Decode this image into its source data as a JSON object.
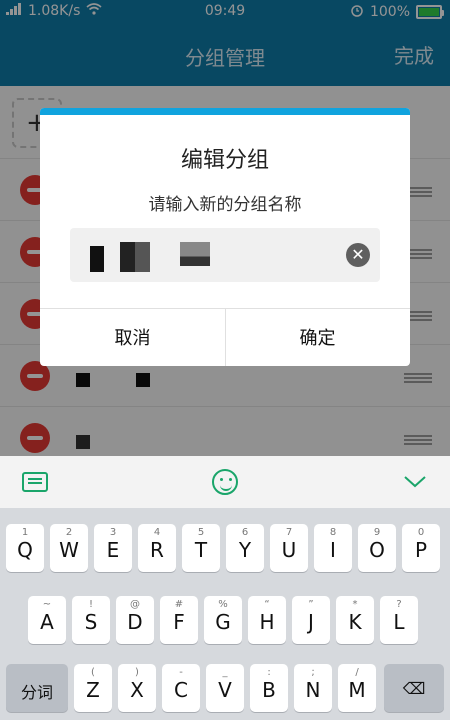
{
  "status_bar": {
    "network_speed": "1.08K/s",
    "time": "09:49",
    "battery": "100%"
  },
  "header": {
    "title": "分组管理",
    "done": "完成"
  },
  "list": {
    "add_symbol": "+"
  },
  "dialog": {
    "title": "编辑分组",
    "subtitle": "请输入新的分组名称",
    "cancel": "取消",
    "confirm": "确定",
    "clear_symbol": "✕"
  },
  "keyboard": {
    "row1": [
      {
        "key": "Q",
        "hint": "1"
      },
      {
        "key": "W",
        "hint": "2"
      },
      {
        "key": "E",
        "hint": "3"
      },
      {
        "key": "R",
        "hint": "4"
      },
      {
        "key": "T",
        "hint": "5"
      },
      {
        "key": "Y",
        "hint": "6"
      },
      {
        "key": "U",
        "hint": "7"
      },
      {
        "key": "I",
        "hint": "8"
      },
      {
        "key": "O",
        "hint": "9"
      },
      {
        "key": "P",
        "hint": "0"
      }
    ],
    "row2": [
      {
        "key": "A",
        "hint": "~"
      },
      {
        "key": "S",
        "hint": "!"
      },
      {
        "key": "D",
        "hint": "@"
      },
      {
        "key": "F",
        "hint": "#"
      },
      {
        "key": "G",
        "hint": "%"
      },
      {
        "key": "H",
        "hint": "“"
      },
      {
        "key": "J",
        "hint": "”"
      },
      {
        "key": "K",
        "hint": "*"
      },
      {
        "key": "L",
        "hint": "?"
      }
    ],
    "row3": [
      {
        "key": "Z",
        "hint": "("
      },
      {
        "key": "X",
        "hint": ")"
      },
      {
        "key": "C",
        "hint": "-"
      },
      {
        "key": "V",
        "hint": "_"
      },
      {
        "key": "B",
        "hint": ":"
      },
      {
        "key": "N",
        "hint": ";"
      },
      {
        "key": "M",
        "hint": "/"
      }
    ],
    "segment_key": "分词",
    "backspace_symbol": "⌫"
  }
}
